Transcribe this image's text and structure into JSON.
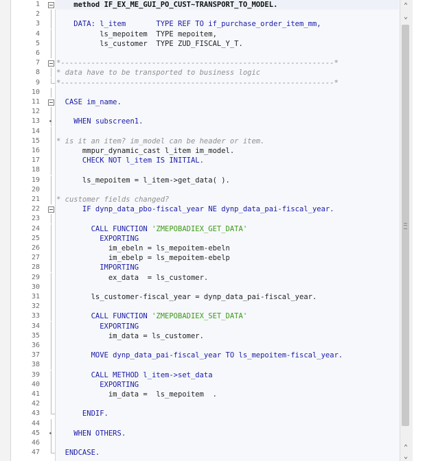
{
  "editor": {
    "lines": [
      {
        "n": "1",
        "fold": "box",
        "code": "    method IF_EX_ME_GUI_PO_CUST~TRANSPORT_TO_MODEL.",
        "cls": "tok-bold"
      },
      {
        "n": "2",
        "fold": "line",
        "code": "",
        "cls": "tok-id"
      },
      {
        "n": "3",
        "fold": "line",
        "code": "    DATA: l_item       TYPE REF TO if_purchase_order_item_mm,",
        "cls": "tok-kw"
      },
      {
        "n": "4",
        "fold": "line",
        "code": "          ls_mepoitem  TYPE mepoitem,",
        "cls": "tok-id"
      },
      {
        "n": "5",
        "fold": "line",
        "code": "          ls_customer  TYPE ZUD_FISCAL_Y_T.",
        "cls": "tok-id"
      },
      {
        "n": "6",
        "fold": "line",
        "code": "",
        "cls": "tok-id"
      },
      {
        "n": "7",
        "fold": "box",
        "code": "*---------------------------------------------------------------*",
        "cls": "tok-cmt"
      },
      {
        "n": "8",
        "fold": "line",
        "code": "* data have to be transported to business logic",
        "cls": "tok-cmt"
      },
      {
        "n": "9",
        "fold": "end",
        "code": "*---------------------------------------------------------------*",
        "cls": "tok-cmt"
      },
      {
        "n": "10",
        "fold": "line",
        "code": "",
        "cls": "tok-id"
      },
      {
        "n": "11",
        "fold": "box",
        "code": "  CASE im_name.",
        "cls": "tok-kw"
      },
      {
        "n": "12",
        "fold": "line",
        "code": "",
        "cls": "tok-id"
      },
      {
        "n": "13",
        "fold": "dot",
        "code": "    WHEN subscreen1.",
        "cls": "tok-kw"
      },
      {
        "n": "14",
        "fold": "line",
        "code": "",
        "cls": "tok-id"
      },
      {
        "n": "15",
        "fold": "line",
        "code": "* is it an item? im_model can be header or item.",
        "cls": "tok-cmt"
      },
      {
        "n": "16",
        "fold": "line",
        "code": "      mmpur_dynamic_cast l_item im_model.",
        "cls": "tok-id"
      },
      {
        "n": "17",
        "fold": "line",
        "code": "      CHECK NOT l_item IS INITIAL.",
        "cls": "tok-kw"
      },
      {
        "n": "18",
        "fold": "line",
        "code": "",
        "cls": "tok-id"
      },
      {
        "n": "19",
        "fold": "line",
        "code": "      ls_mepoitem = l_item->get_data( ).",
        "cls": "tok-id"
      },
      {
        "n": "20",
        "fold": "line",
        "code": "",
        "cls": "tok-id"
      },
      {
        "n": "21",
        "fold": "line",
        "code": "* customer fields changed?",
        "cls": "tok-cmt"
      },
      {
        "n": "22",
        "fold": "box",
        "code": "      IF dynp_data_pbo-fiscal_year NE dynp_data_pai-fiscal_year.",
        "cls": "tok-kw"
      },
      {
        "n": "23",
        "fold": "line",
        "code": "",
        "cls": "tok-id"
      },
      {
        "n": "24",
        "fold": "line",
        "code": "        CALL FUNCTION 'ZMEPOBADIEX_GET_DATA'",
        "cls": "tok-kw"
      },
      {
        "n": "25",
        "fold": "line",
        "code": "          EXPORTING",
        "cls": "tok-kw"
      },
      {
        "n": "26",
        "fold": "line",
        "code": "            im_ebeln = ls_mepoitem-ebeln",
        "cls": "tok-id"
      },
      {
        "n": "27",
        "fold": "line",
        "code": "            im_ebelp = ls_mepoitem-ebelp",
        "cls": "tok-id"
      },
      {
        "n": "28",
        "fold": "line",
        "code": "          IMPORTING",
        "cls": "tok-kw"
      },
      {
        "n": "29",
        "fold": "line",
        "code": "            ex_data  = ls_customer.",
        "cls": "tok-id"
      },
      {
        "n": "30",
        "fold": "line",
        "code": "",
        "cls": "tok-id"
      },
      {
        "n": "31",
        "fold": "line",
        "code": "        ls_customer-fiscal_year = dynp_data_pai-fiscal_year.",
        "cls": "tok-id"
      },
      {
        "n": "32",
        "fold": "line",
        "code": "",
        "cls": "tok-id"
      },
      {
        "n": "33",
        "fold": "line",
        "code": "        CALL FUNCTION 'ZMEPOBADIEX_SET_DATA'",
        "cls": "tok-kw"
      },
      {
        "n": "34",
        "fold": "line",
        "code": "          EXPORTING",
        "cls": "tok-kw"
      },
      {
        "n": "35",
        "fold": "line",
        "code": "            im_data = ls_customer.",
        "cls": "tok-id"
      },
      {
        "n": "36",
        "fold": "line",
        "code": "",
        "cls": "tok-id"
      },
      {
        "n": "37",
        "fold": "line",
        "code": "        MOVE dynp_data_pai-fiscal_year TO ls_mepoitem-fiscal_year.",
        "cls": "tok-kw"
      },
      {
        "n": "38",
        "fold": "line",
        "code": "",
        "cls": "tok-id"
      },
      {
        "n": "39",
        "fold": "line",
        "code": "        CALL METHOD l_item->set_data",
        "cls": "tok-kw"
      },
      {
        "n": "40",
        "fold": "line",
        "code": "          EXPORTING",
        "cls": "tok-kw"
      },
      {
        "n": "41",
        "fold": "line",
        "code": "            im_data =  ls_mepoitem  .",
        "cls": "tok-id"
      },
      {
        "n": "42",
        "fold": "line",
        "code": "",
        "cls": "tok-id"
      },
      {
        "n": "43",
        "fold": "end",
        "code": "      ENDIF.",
        "cls": "tok-kw"
      },
      {
        "n": "44",
        "fold": "line",
        "code": "",
        "cls": "tok-id"
      },
      {
        "n": "45",
        "fold": "dot",
        "code": "    WHEN OTHERS.",
        "cls": "tok-kw"
      },
      {
        "n": "46",
        "fold": "line",
        "code": "",
        "cls": "tok-id"
      },
      {
        "n": "47",
        "fold": "end",
        "code": "  ENDCASE.",
        "cls": "tok-kw"
      }
    ]
  },
  "scrollbar": {
    "up_glyph": "⌃",
    "down_glyph": "⌄"
  },
  "colors": {
    "keyword": "#1a1aa6",
    "string": "#3d9a17",
    "comment": "#8f8f8f",
    "background": "#f6f8fb"
  },
  "icons": {
    "fold_expanded": "minus-box-icon",
    "fold_leaf": "dot-icon"
  }
}
